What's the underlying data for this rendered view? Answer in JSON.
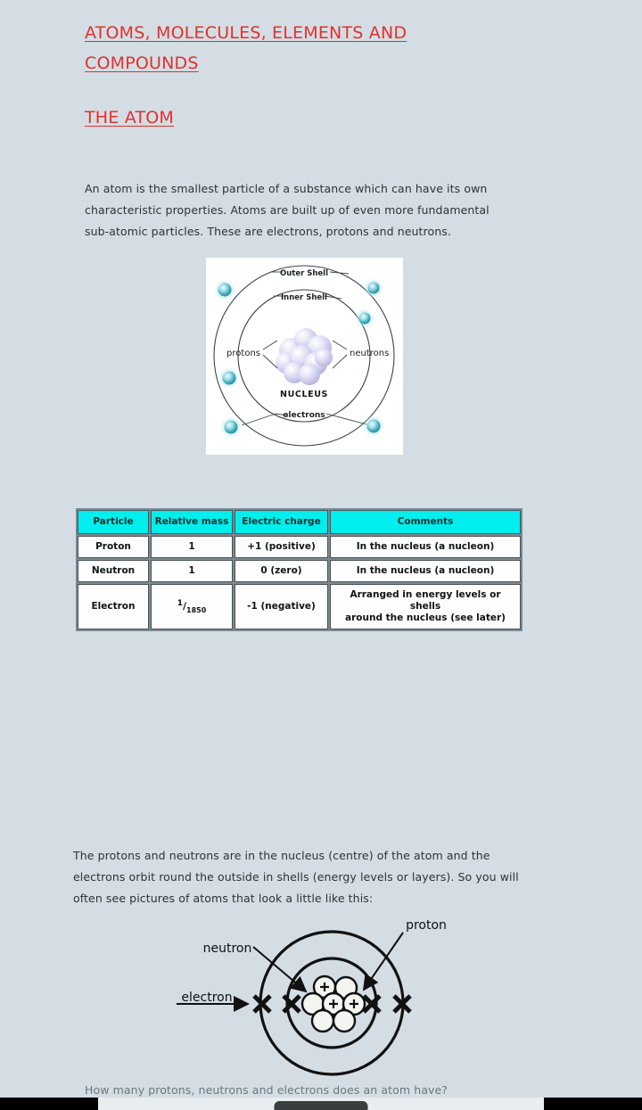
{
  "document": {
    "title_line1": "ATOMS, MOLECULES, ELEMENTS AND",
    "title_line2": "COMPOUNDS",
    "subtitle": "THE ATOM",
    "intro_paragraph": "An atom is the smallest particle of a substance which can have its own characteristic properties. Atoms are built up of even more fundamental sub-atomic particles. These are electrons, protons and neutrons.",
    "shells_paragraph": "The protons and neutrons are in the nucleus (centre) of the atom and the electrons orbit round the outside in shells (energy levels or layers). So you will often see pictures of atoms that look a little like this:",
    "question_line": "How many protons, neutrons and electrons does an atom have?"
  },
  "atom_figure_1": {
    "caption_outer_shell": "Outer Shell",
    "caption_inner_shell": "Inner Shell",
    "caption_protons": "protons",
    "caption_neutrons": "neutrons",
    "caption_nucleus": "NUCLEUS",
    "caption_electrons": "electrons",
    "electron_count": 6,
    "electron_color": "#4fb8c4",
    "nucleon_color": "#c9c8ec",
    "background": "#ffffff"
  },
  "atom_figure_2": {
    "label_proton": "proton",
    "label_neutron": "neutron",
    "label_electron": "electron",
    "shell_count": 2,
    "electron_marks": 4,
    "nucleus_circles": 7,
    "proton_marks": 3,
    "stroke_color": "#111111"
  },
  "particle_table": {
    "header_bg": "#00eeee",
    "columns": [
      "Particle",
      "Relative mass",
      "Electric charge",
      "Comments"
    ],
    "rows": [
      {
        "particle": "Proton",
        "relative_mass": "1",
        "mass_is_fraction": false,
        "electric_charge": "+1 (positive)",
        "comments_line1": "In the nucleus (a nucleon)",
        "comments_line2": ""
      },
      {
        "particle": "Neutron",
        "relative_mass": "1",
        "mass_is_fraction": false,
        "electric_charge": "0 (zero)",
        "comments_line1": "In the nucleus (a nucleon)",
        "comments_line2": ""
      },
      {
        "particle": "Electron",
        "relative_mass": "1/1850",
        "mass_numerator": "1",
        "mass_denominator": "1850",
        "mass_is_fraction": true,
        "electric_charge": "-1 (negative)",
        "comments_line1": "Arranged in energy levels or shells",
        "comments_line2": "around the nucleus (see later)"
      }
    ]
  },
  "theme": {
    "page_background": "#d4dde3",
    "heading_color": "#e03131",
    "body_text_color": "#2b3436"
  }
}
